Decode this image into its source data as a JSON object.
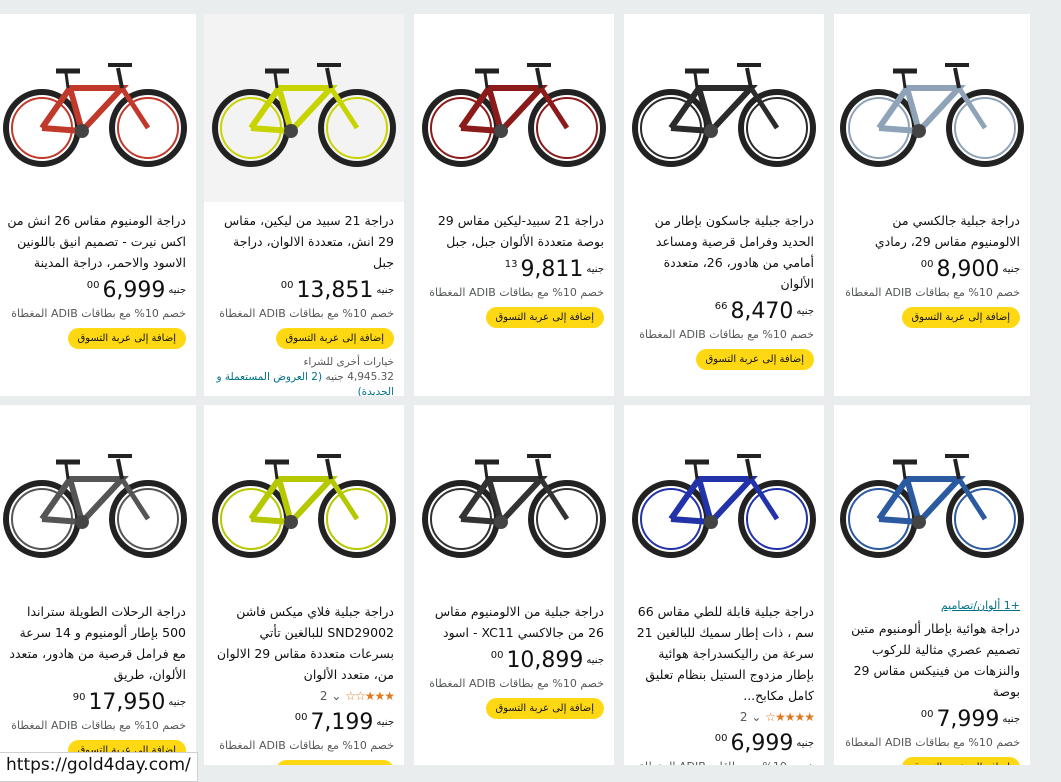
{
  "status_url": "https://gold4day.com/",
  "add_to_cart_label": "إضافة إلى عربة التسوق",
  "discount_text": "خصم 10% مع بطاقات ADIB المغطاة",
  "currency": "جنيه",
  "products": [
    {
      "title": "دراجة جبلية جالكسي من الالومنيوم مقاس 29، رمادي",
      "price_whole": "8,900",
      "price_frac": "00",
      "color": "#8fa3b8"
    },
    {
      "title": "دراجة جبلية جاسكون بإطار من الحديد وفرامل قرصية ومساعد أمامي من هادور، 26، متعددة الألوان",
      "price_whole": "8,470",
      "price_frac": "66",
      "color": "#2b2b2b"
    },
    {
      "title": "دراجة 21 سبيد-ليكين مقاس 29 بوصة متعددة الألوان جبل، جبل",
      "price_whole": "9,811",
      "price_frac": "13",
      "color": "#8b1a1a"
    },
    {
      "title": "دراجة 21 سبيد من ليكين، مقاس 29 انش، متعددة الالوان، دراجة جبل",
      "price_whole": "13,851",
      "price_frac": "00",
      "color": "#c8d400",
      "other_offers_label": "خيارات أخرى للشراء",
      "other_offers_price": "4,945.32",
      "other_offers_link": "(2 العروض المستعملة و الجديدة)"
    },
    {
      "title": "دراجة الومنيوم مقاس 26 انش من اكس نيرت - تصميم انيق باللونين الاسود والاحمر، دراجة المدينة",
      "price_whole": "6,999",
      "price_frac": "00",
      "color": "#c0392b"
    },
    {
      "title": "دراجة هوائية بإطار ألومنيوم متين تصميم عصري مثالية للركوب والنزهات من فينيكس مقاس 29 بوصة",
      "variants": "+1 ألوان/تصاميم",
      "price_whole": "7,999",
      "price_frac": "00",
      "color": "#2c5aa0"
    },
    {
      "title": "دراجة جبلية قابلة للطي مقاس 66 سم ، ذات إطار سميك للبالغين 21 سرعة من راليكسدراجة هوائية بإطار مزدوج الستيل بنظام تعليق كامل مكابح...",
      "rating_count": "2",
      "stars": "★★★★☆",
      "price_whole": "6,999",
      "price_frac": "00",
      "color": "#2233aa"
    },
    {
      "title": "دراجة جبلية من الالومنيوم مقاس 26 من جالاكسي XC11 - اسود",
      "price_whole": "10,899",
      "price_frac": "00",
      "color": "#333333"
    },
    {
      "title": "دراجة جبلية فلاي ميكس فاشن SND29002 للبالغين تأتي بسرعات متعددة مقاس 29 الالوان من، متعدد الألوان",
      "rating_count": "2",
      "stars": "★★★☆☆",
      "price_whole": "7,199",
      "price_frac": "00",
      "color": "#b5c800"
    },
    {
      "title": "دراجة الرحلات الطويلة ستراندا 500 بإطار ألومنيوم و 14 سرعة مع فرامل قرصية من هادور، متعدد الألوان، طريق",
      "price_whole": "17,950",
      "price_frac": "90",
      "color": "#555555"
    }
  ]
}
